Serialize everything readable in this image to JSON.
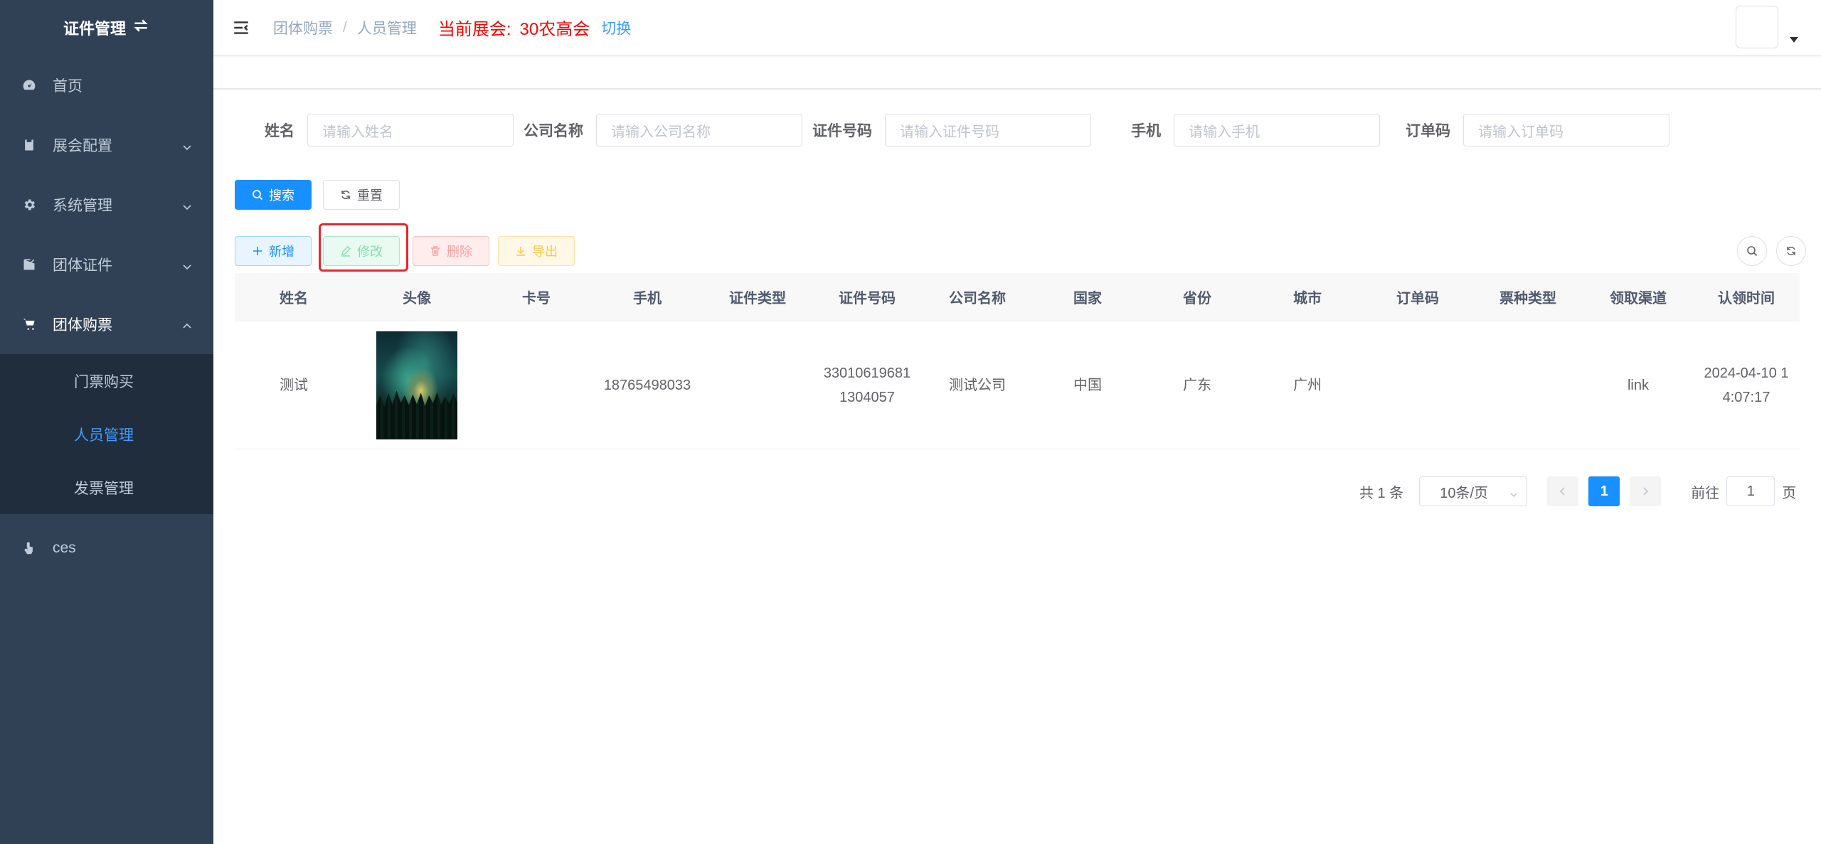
{
  "sidebar": {
    "logo_title": "证件管理",
    "items": [
      {
        "label": "首页",
        "icon": "dashboard-icon"
      },
      {
        "label": "展会配置",
        "icon": "clipboard-icon"
      },
      {
        "label": "系统管理",
        "icon": "gear-icon"
      },
      {
        "label": "团体证件",
        "icon": "edit-icon"
      },
      {
        "label": "团体购票",
        "icon": "cart-icon"
      }
    ],
    "sub_items": [
      {
        "label": "门票购买"
      },
      {
        "label": "人员管理"
      },
      {
        "label": "发票管理"
      }
    ],
    "extra_item": {
      "label": "ces",
      "icon": "hand-pointer-icon"
    }
  },
  "header": {
    "breadcrumb": [
      "团体购票",
      "人员管理"
    ],
    "expo_label": "当前展会:",
    "expo_name": "30农高会",
    "switch_label": "切换"
  },
  "search": {
    "fields": [
      {
        "label": "姓名",
        "placeholder": "请输入姓名"
      },
      {
        "label": "公司名称",
        "placeholder": "请输入公司名称"
      },
      {
        "label": "证件号码",
        "placeholder": "请输入证件号码"
      },
      {
        "label": "手机",
        "placeholder": "请输入手机"
      },
      {
        "label": "订单码",
        "placeholder": "请输入订单码"
      }
    ],
    "search_label": "搜索",
    "reset_label": "重置"
  },
  "toolbar": {
    "add_label": "新增",
    "edit_label": "修改",
    "delete_label": "删除",
    "export_label": "导出"
  },
  "table": {
    "columns": [
      "姓名",
      "头像",
      "卡号",
      "手机",
      "证件类型",
      "证件号码",
      "公司名称",
      "国家",
      "省份",
      "城市",
      "订单码",
      "票种类型",
      "领取渠道",
      "认领时间"
    ],
    "rows": [
      {
        "name": "测试",
        "card_no": "",
        "phone": "18765498033",
        "id_type": "",
        "id_no_line1": "33010619681",
        "id_no_line2": "1304057",
        "company": "测试公司",
        "country": "中国",
        "province": "广东",
        "city": "广州",
        "order_code": "",
        "ticket_type": "",
        "channel": "link",
        "claim_time_line1": "2024-04-10 1",
        "claim_time_line2": "4:07:17"
      }
    ]
  },
  "pagination": {
    "total_text": "共 1 条",
    "page_size": "10条/页",
    "current_page": "1",
    "goto_label": "前往",
    "goto_value": "1",
    "page_suffix": "页"
  },
  "colors": {
    "sidebar_bg": "#304156",
    "primary": "#1890ff",
    "danger_highlight": "#e6262c",
    "expo_red": "#ff0000"
  }
}
